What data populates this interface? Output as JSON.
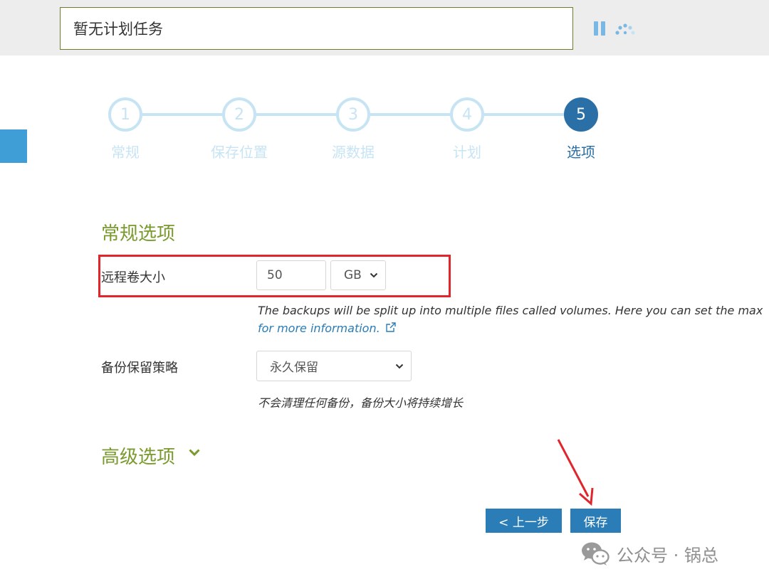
{
  "status": {
    "text": "暂无计划任务",
    "pause_icon": "pause-icon",
    "spinner_icon": "spinner-icon",
    "accent": "#79b7e4"
  },
  "stepper": {
    "steps": [
      {
        "number": "1",
        "label": "常规",
        "active": false
      },
      {
        "number": "2",
        "label": "保存位置",
        "active": false
      },
      {
        "number": "3",
        "label": "源数据",
        "active": false
      },
      {
        "number": "4",
        "label": "计划",
        "active": false
      },
      {
        "number": "5",
        "label": "选项",
        "active": true
      }
    ],
    "inactive_color": "#c7e4f5",
    "active_color": "#2a6fa6"
  },
  "general": {
    "title": "常规选项",
    "volume_size": {
      "label": "远程卷大小",
      "value": "50",
      "unit": "GB",
      "help_text": "The backups will be split up into multiple files called volumes. Here you can set the max",
      "help_link": "for more information."
    },
    "retention": {
      "label": "备份保留策略",
      "value": "永久保留",
      "help_text": "不会清理任何备份，备份大小将持续增长"
    }
  },
  "advanced": {
    "title": "高级选项"
  },
  "actions": {
    "previous_label": "< 上一步",
    "save_label": "保存"
  },
  "watermark": {
    "text": "公众号 · 锅总",
    "icon": "wechat-icon"
  },
  "colors": {
    "section_title": "#7a9a2e",
    "button": "#2a7db6",
    "annotation": "#e0262c"
  }
}
